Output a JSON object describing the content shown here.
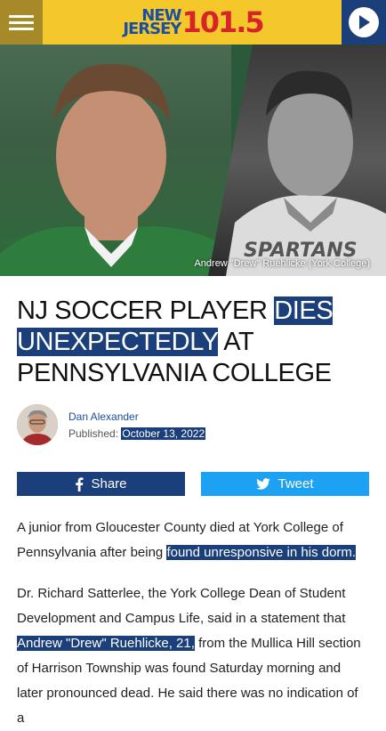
{
  "header": {
    "logo_line1": "NEW",
    "logo_line2": "JERSEY",
    "logo_freq": "101.5",
    "colors": {
      "bar": "#f4c82a",
      "menu": "#a68a2a",
      "play": "#1a3f7a"
    }
  },
  "hero": {
    "caption": "Andrew \"Drew\" Ruehlicke (York College)"
  },
  "article": {
    "headline_part1": "NJ SOCCER PLAYER ",
    "headline_highlight": "DIES UNEXPECTEDLY",
    "headline_part2": " AT PENNSYLVANIA COLLEGE",
    "author": "Dan Alexander",
    "published_label": "Published:",
    "published_date": "October 13, 2022",
    "share_facebook": "Share",
    "share_twitter": "Tweet",
    "p1_text": "A junior from Gloucester County died at York College of Pennsylvania after being ",
    "p1_highlight": "found unresponsive in his dorm.",
    "p2_text1": "Dr. Richard Satterlee, the York College Dean of Student Development and Campus Life, said in a statement that ",
    "p2_highlight": "Andrew \"Drew\" Ruehlicke, 21,",
    "p2_text2": " from the Mullica Hill section of Harrison Township was found Saturday morning and later pronounced dead. He said there was no indication of a"
  },
  "icons": {
    "menu": "hamburger-icon",
    "play": "play-icon",
    "facebook": "facebook-icon",
    "twitter": "twitter-icon"
  },
  "colors": {
    "highlight": "#1a3f7a",
    "twitter": "#1da1f2",
    "facebook": "#1a3f7a"
  }
}
